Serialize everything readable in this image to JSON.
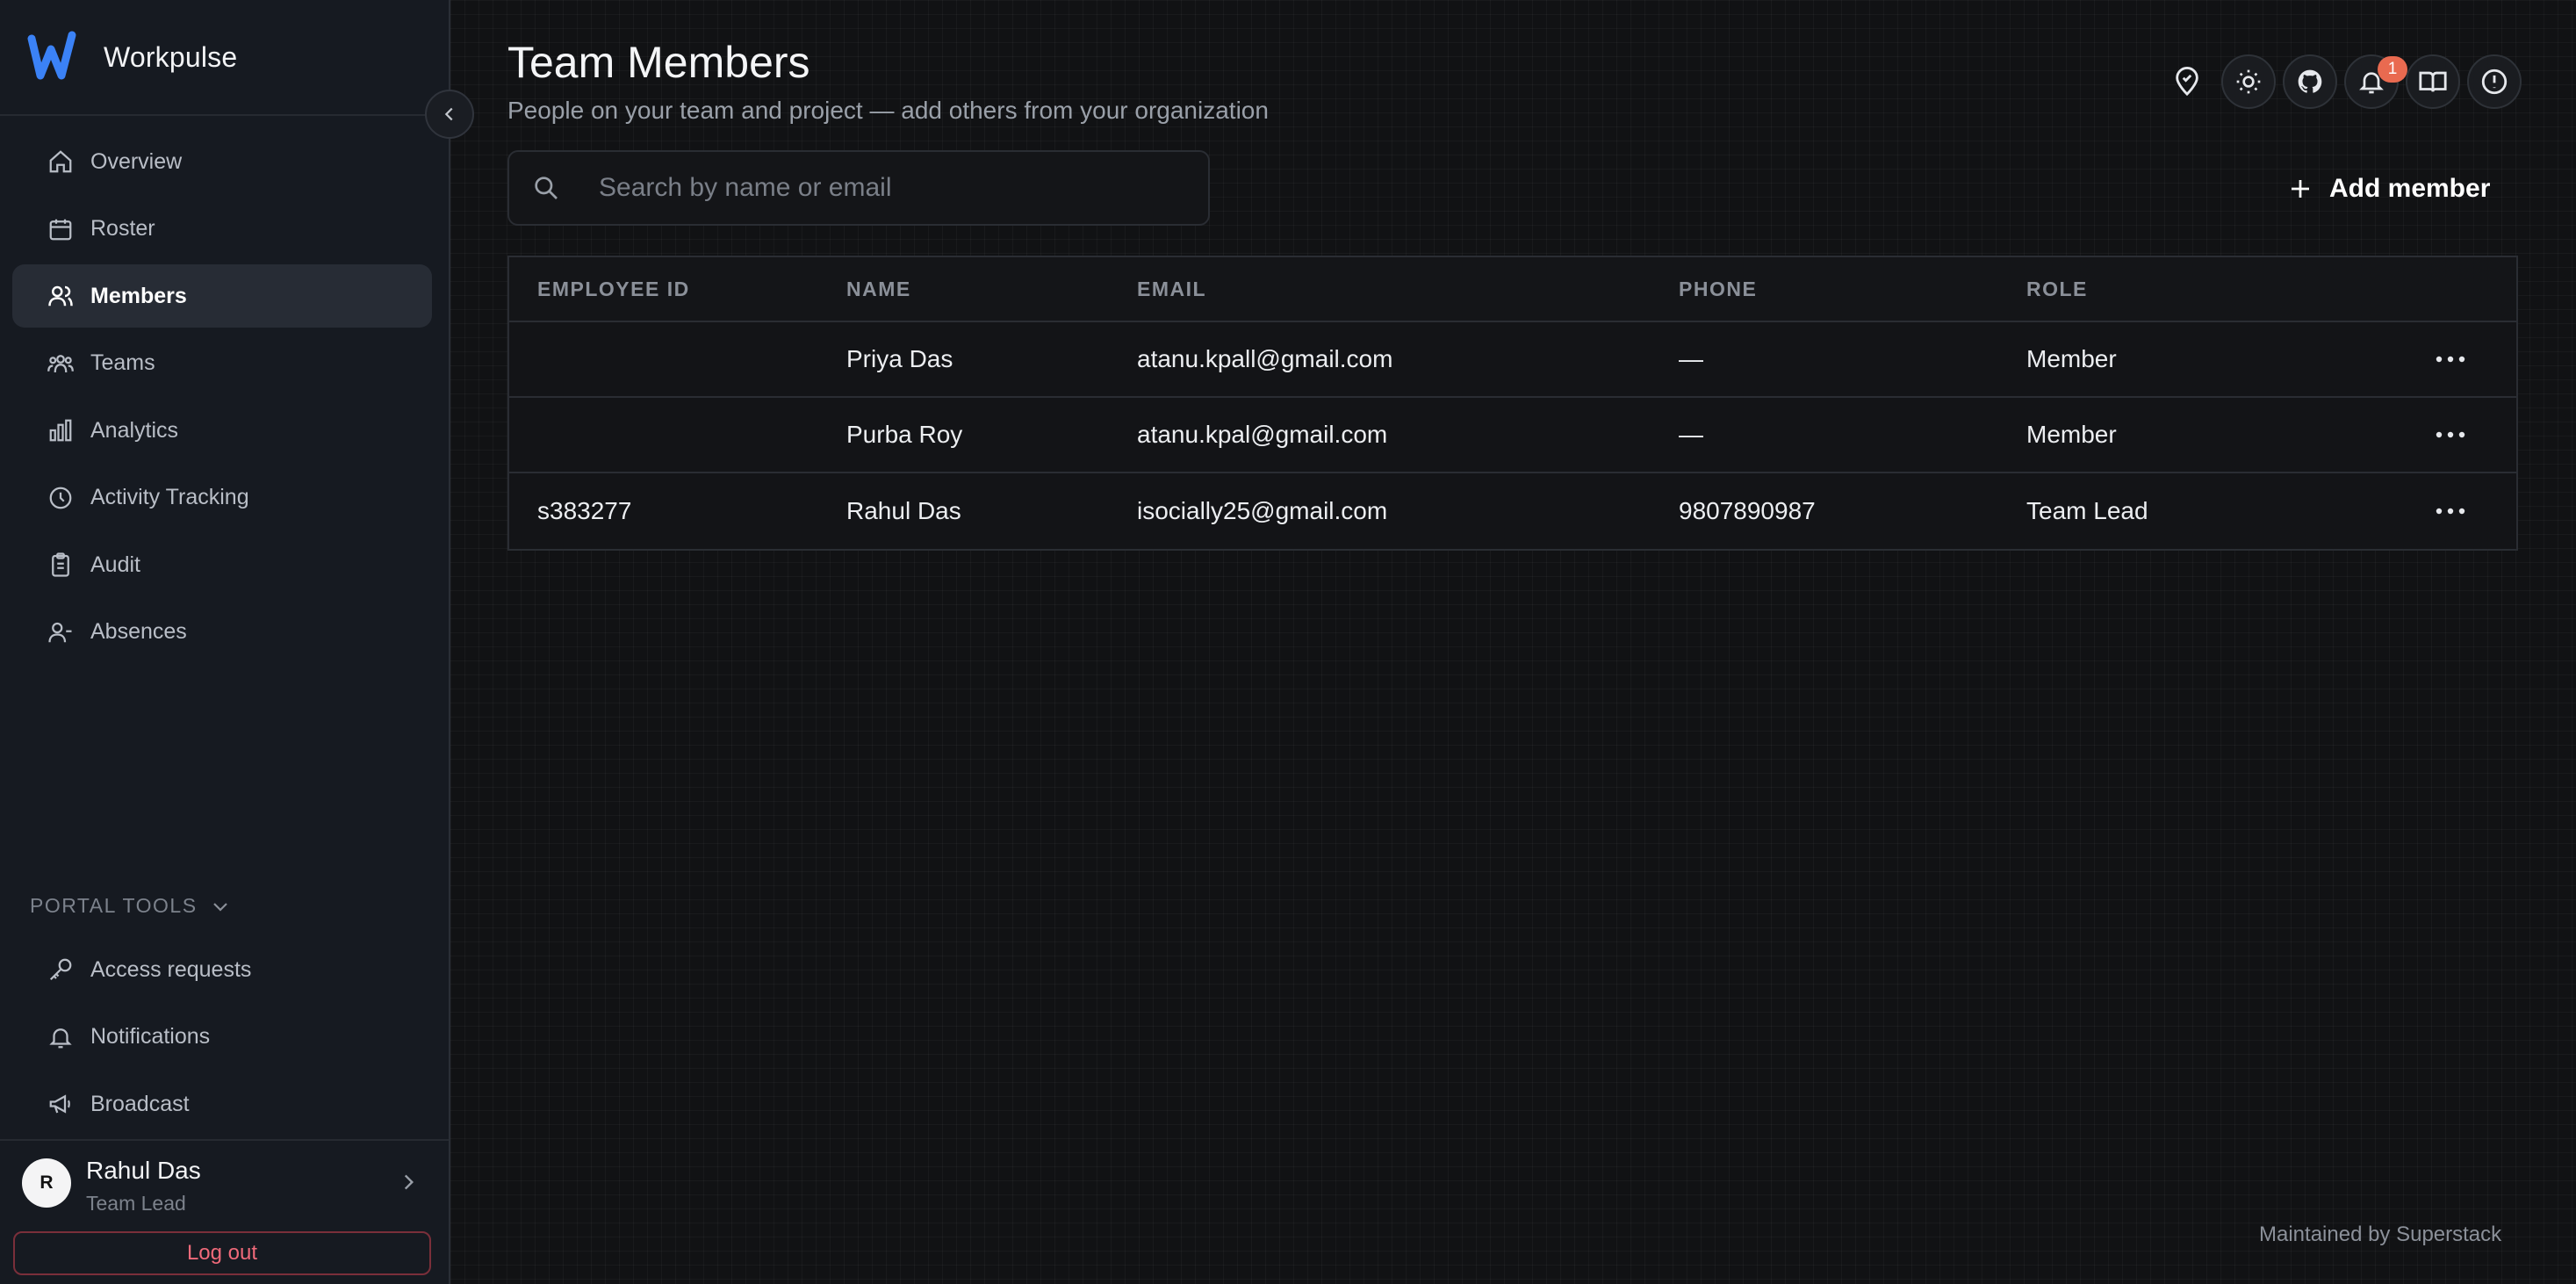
{
  "brand": {
    "name": "Workpulse"
  },
  "nav": {
    "items": [
      {
        "label": "Overview",
        "icon": "home-icon"
      },
      {
        "label": "Roster",
        "icon": "calendar-icon"
      },
      {
        "label": "Members",
        "icon": "users-icon",
        "active": true
      },
      {
        "label": "Teams",
        "icon": "group-icon"
      },
      {
        "label": "Analytics",
        "icon": "bar-chart-icon"
      },
      {
        "label": "Activity Tracking",
        "icon": "clock-icon"
      },
      {
        "label": "Audit",
        "icon": "clipboard-icon"
      },
      {
        "label": "Absences",
        "icon": "user-minus-icon"
      }
    ]
  },
  "portal_tools": {
    "heading": "PORTAL TOOLS",
    "items": [
      {
        "label": "Access requests",
        "icon": "key-icon"
      },
      {
        "label": "Notifications",
        "icon": "bell-icon"
      },
      {
        "label": "Broadcast",
        "icon": "megaphone-icon"
      }
    ]
  },
  "user": {
    "initial": "R",
    "name": "Rahul Das",
    "role": "Team Lead",
    "logout_label": "Log out"
  },
  "header": {
    "title": "Team Members",
    "subtitle": "People on your team and project — add others from your organization",
    "notification_count": "1"
  },
  "search": {
    "placeholder": "Search by name or email",
    "value": ""
  },
  "actions": {
    "add_member_label": "Add member"
  },
  "table": {
    "columns": [
      "EMPLOYEE ID",
      "NAME",
      "EMAIL",
      "PHONE",
      "ROLE"
    ],
    "rows": [
      {
        "employee_id": "",
        "name": "Priya Das",
        "email": "atanu.kpall@gmail.com",
        "phone": "—",
        "role": "Member"
      },
      {
        "employee_id": "",
        "name": "Purba Roy",
        "email": "atanu.kpal@gmail.com",
        "phone": "—",
        "role": "Member"
      },
      {
        "employee_id": "s383277",
        "name": "Rahul Das",
        "email": "isocially25@gmail.com",
        "phone": "9807890987",
        "role": "Team Lead"
      }
    ]
  },
  "footer": {
    "note": "Maintained by Superstack"
  },
  "colors": {
    "accent": "#3b82f6",
    "badge": "#e96a50",
    "logout": "#f06a7a"
  }
}
